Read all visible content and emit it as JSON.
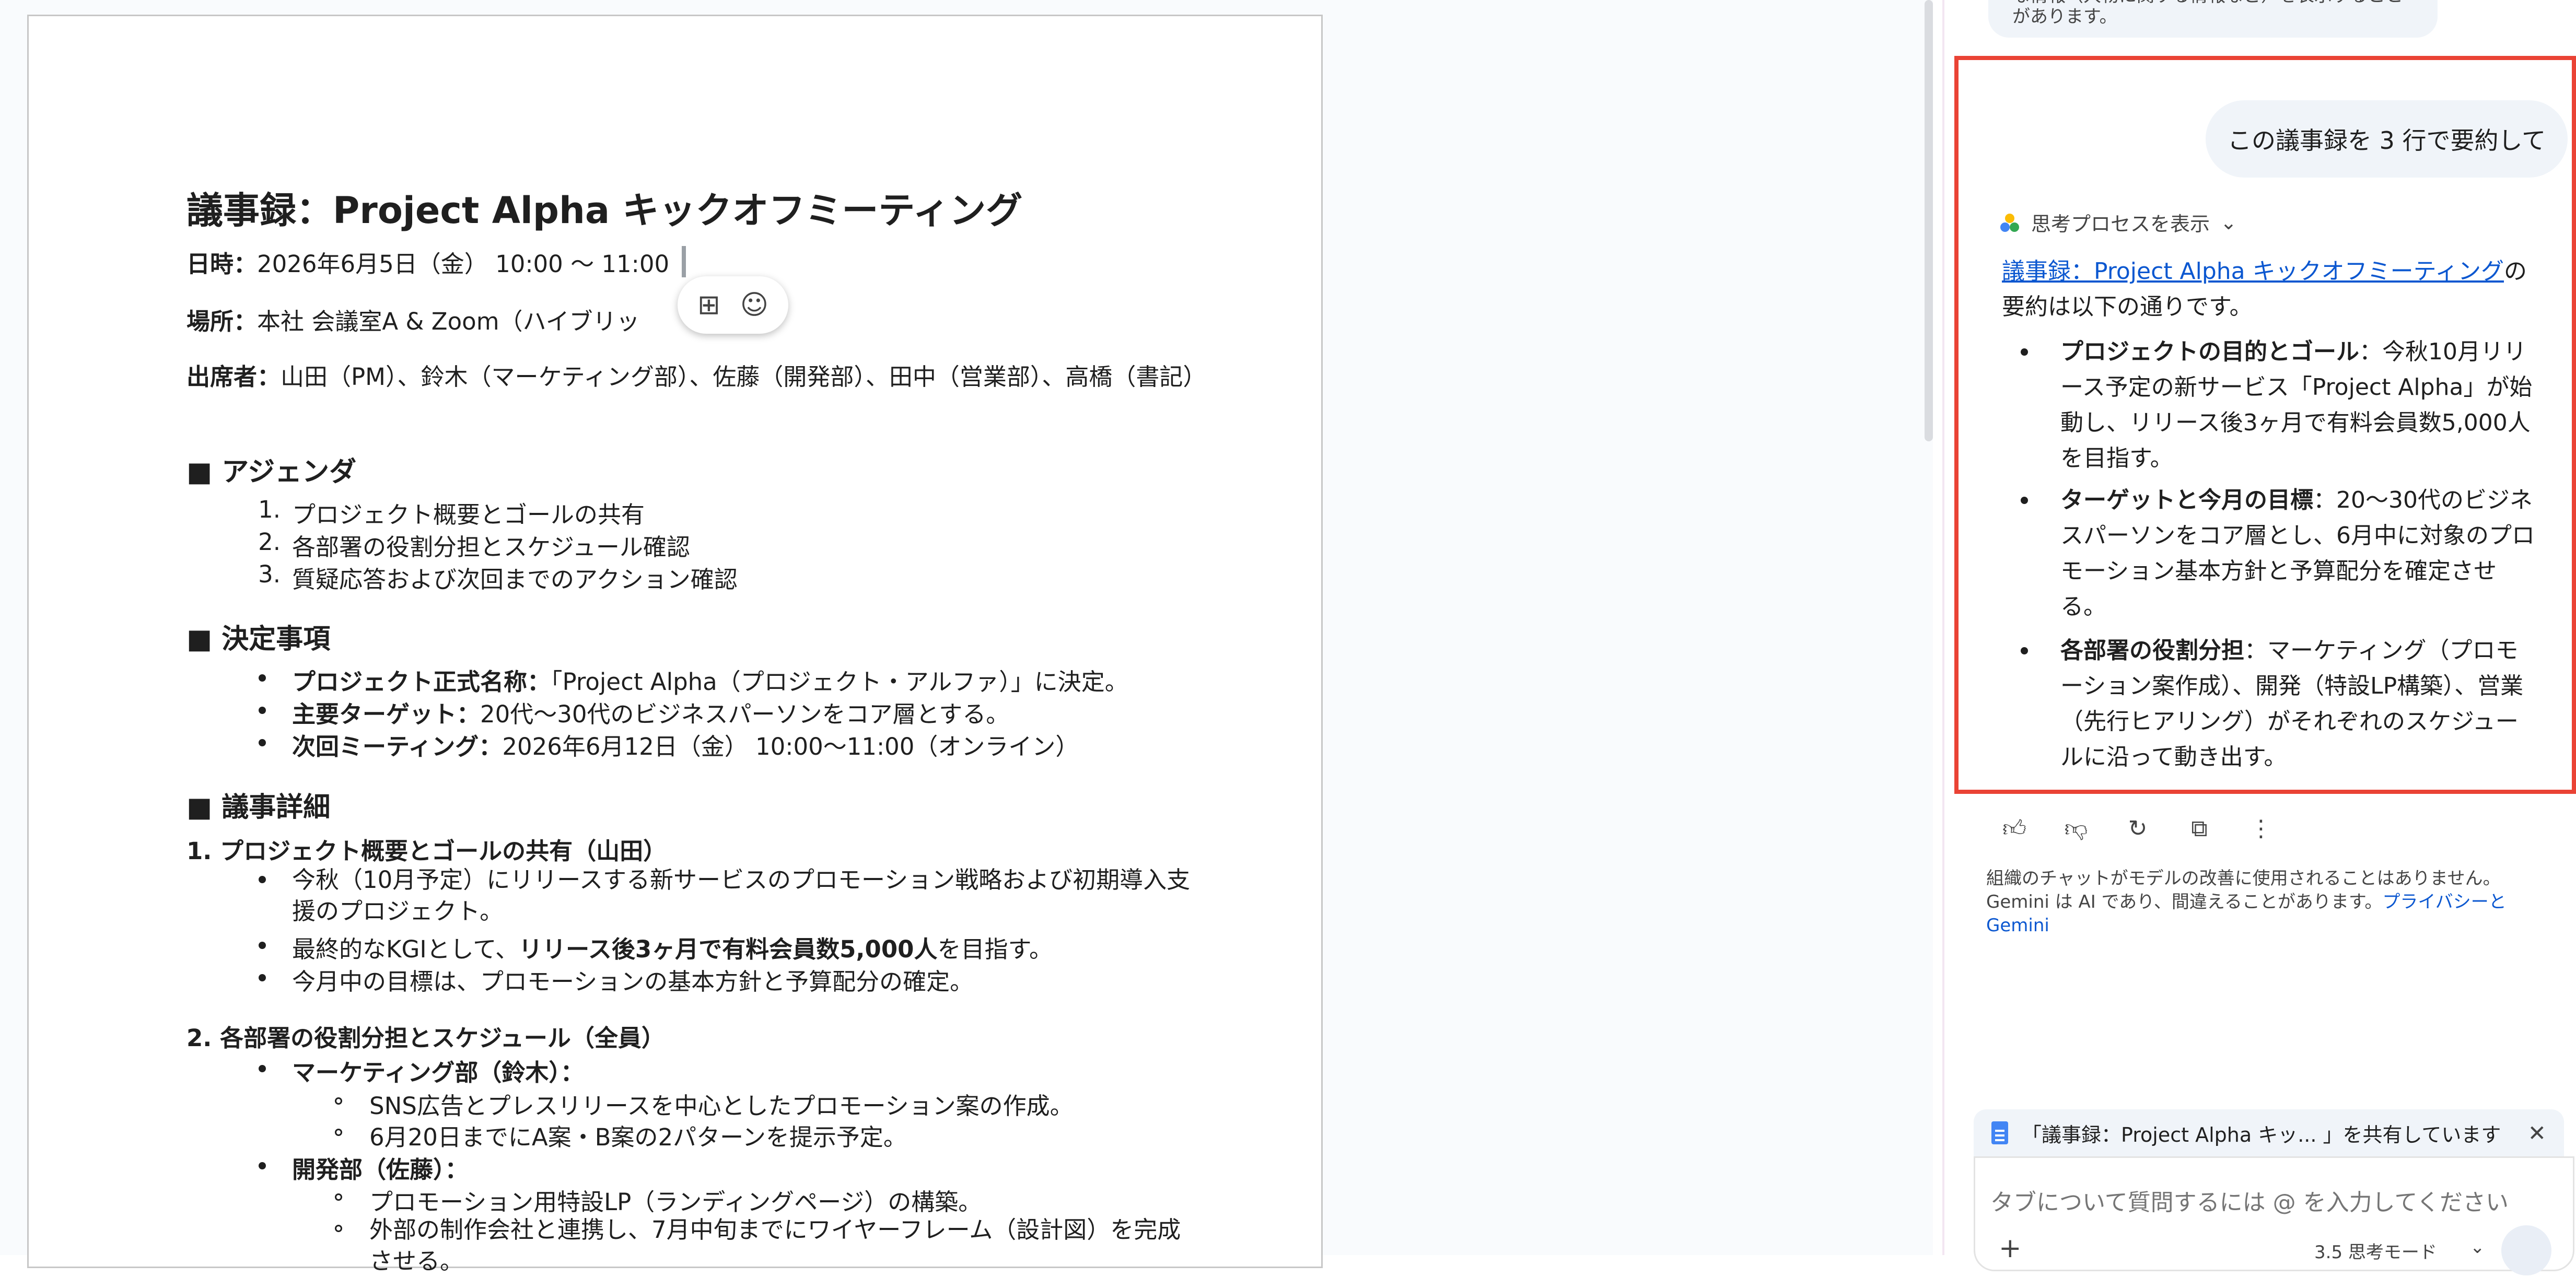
{
  "document": {
    "title": "議事録：Project Alpha キックオフミーティング",
    "date_label": "日時：",
    "date_value": "2026年6月5日（金） 10:00 〜 11:00",
    "place_label": "場所：",
    "place_value": "本社 会議室A & Zoom（ハイブリッ",
    "attendees_label": "出席者：",
    "attendees_value": "山田（PM）、鈴木（マーケティング部）、佐藤（開発部）、田中（営業部）、高橋（書記）",
    "agenda_heading": "■ アジェンダ",
    "agenda": [
      {
        "num": "1.",
        "text": "プロジェクト概要とゴールの共有"
      },
      {
        "num": "2.",
        "text": "各部署の役割分担とスケジュール確認"
      },
      {
        "num": "3.",
        "text": "質疑応答および次回までのアクション確認"
      }
    ],
    "decisions_heading": "■ 決定事項",
    "decisions": [
      {
        "label": "プロジェクト正式名称：",
        "text": "「Project Alpha（プロジェクト・アルファ）」に決定。"
      },
      {
        "label": "主要ターゲット：",
        "text": "20代〜30代のビジネスパーソンをコア層とする。"
      },
      {
        "label": "次回ミーティング：",
        "text": "2026年6月12日（金） 10:00〜11:00（オンライン）"
      }
    ],
    "details_heading": "■ 議事詳細",
    "section1_heading": "1. プロジェクト概要とゴールの共有（山田）",
    "section1_items": [
      "今秋（10月予定）にリリースする新サービスのプロモーション戦略および初期導入支援のプロジェクト。",
      "最終的なKGIとして、",
      "今月中の目標は、プロモーションの基本方針と予算配分の確定。"
    ],
    "section1_bold": "リリース後3ヶ月で有料会員数5,000人",
    "section1_tail": "を目指す。",
    "section2_heading": "2. 各部署の役割分担とスケジュール（全員）",
    "marketing_label": "マーケティング部（鈴木）：",
    "marketing_items": [
      "SNS広告とプレスリリースを中心としたプロモーション案の作成。",
      "6月20日までにA案・B案の2パターンを提示予定。"
    ],
    "dev_label": "開発部（佐藤）：",
    "dev_items": [
      "プロモーション用特設LP（ランディングページ）の構築。",
      "外部の制作会社と連携し、7月中旬までにワイヤーフレーム（設計図）を完成させる。"
    ]
  },
  "floater": {
    "add_comment_icon": "add-comment-icon",
    "emoji_icon": "emoji-icon"
  },
  "panel": {
    "prev_message": "な情報（人物に関する情報など）を表示することがあります。",
    "user_message": "この議事録を 3 行で要約して",
    "think_label": "思考プロセスを表示",
    "response_link": "議事録：Project Alpha キックオフミーティング",
    "response_intro_tail": "の要約は以下の通りです。",
    "bullets": [
      {
        "label": "プロジェクトの目的とゴール",
        "text": "：今秋10月リリース予定の新サービス「Project Alpha」が始動し、リリース後3ヶ月で有料会員数5,000人を目指す。"
      },
      {
        "label": "ターゲットと今月の目標",
        "text": "：20〜30代のビジネスパーソンをコア層とし、6月中に対象のプロモーション基本方針と予算配分を確定させる。"
      },
      {
        "label": "各部署の役割分担",
        "text": "：マーケティング（プロモーション案作成）、開発（特設LP構築）、営業（先行ヒアリング）がそれぞれのスケジュールに沿って動き出す。"
      }
    ],
    "actions": [
      "thumbs-up-icon",
      "thumbs-down-icon",
      "regenerate-icon",
      "copy-icon",
      "more-icon"
    ],
    "disclaimer": "組織のチャットがモデルの改善に使用されることはありません。Gemini は AI であり、間違えることがあります。",
    "disclaimer_link": "プライバシーと Gemini",
    "share_text": "「議事録：Project Alpha キッ... 」を共有しています",
    "input_placeholder": "タブについて質問するには @ を入力してください",
    "mode_label": "3.5 思考モード",
    "accent": "#0b57d0",
    "highlight": "#ea4335"
  }
}
